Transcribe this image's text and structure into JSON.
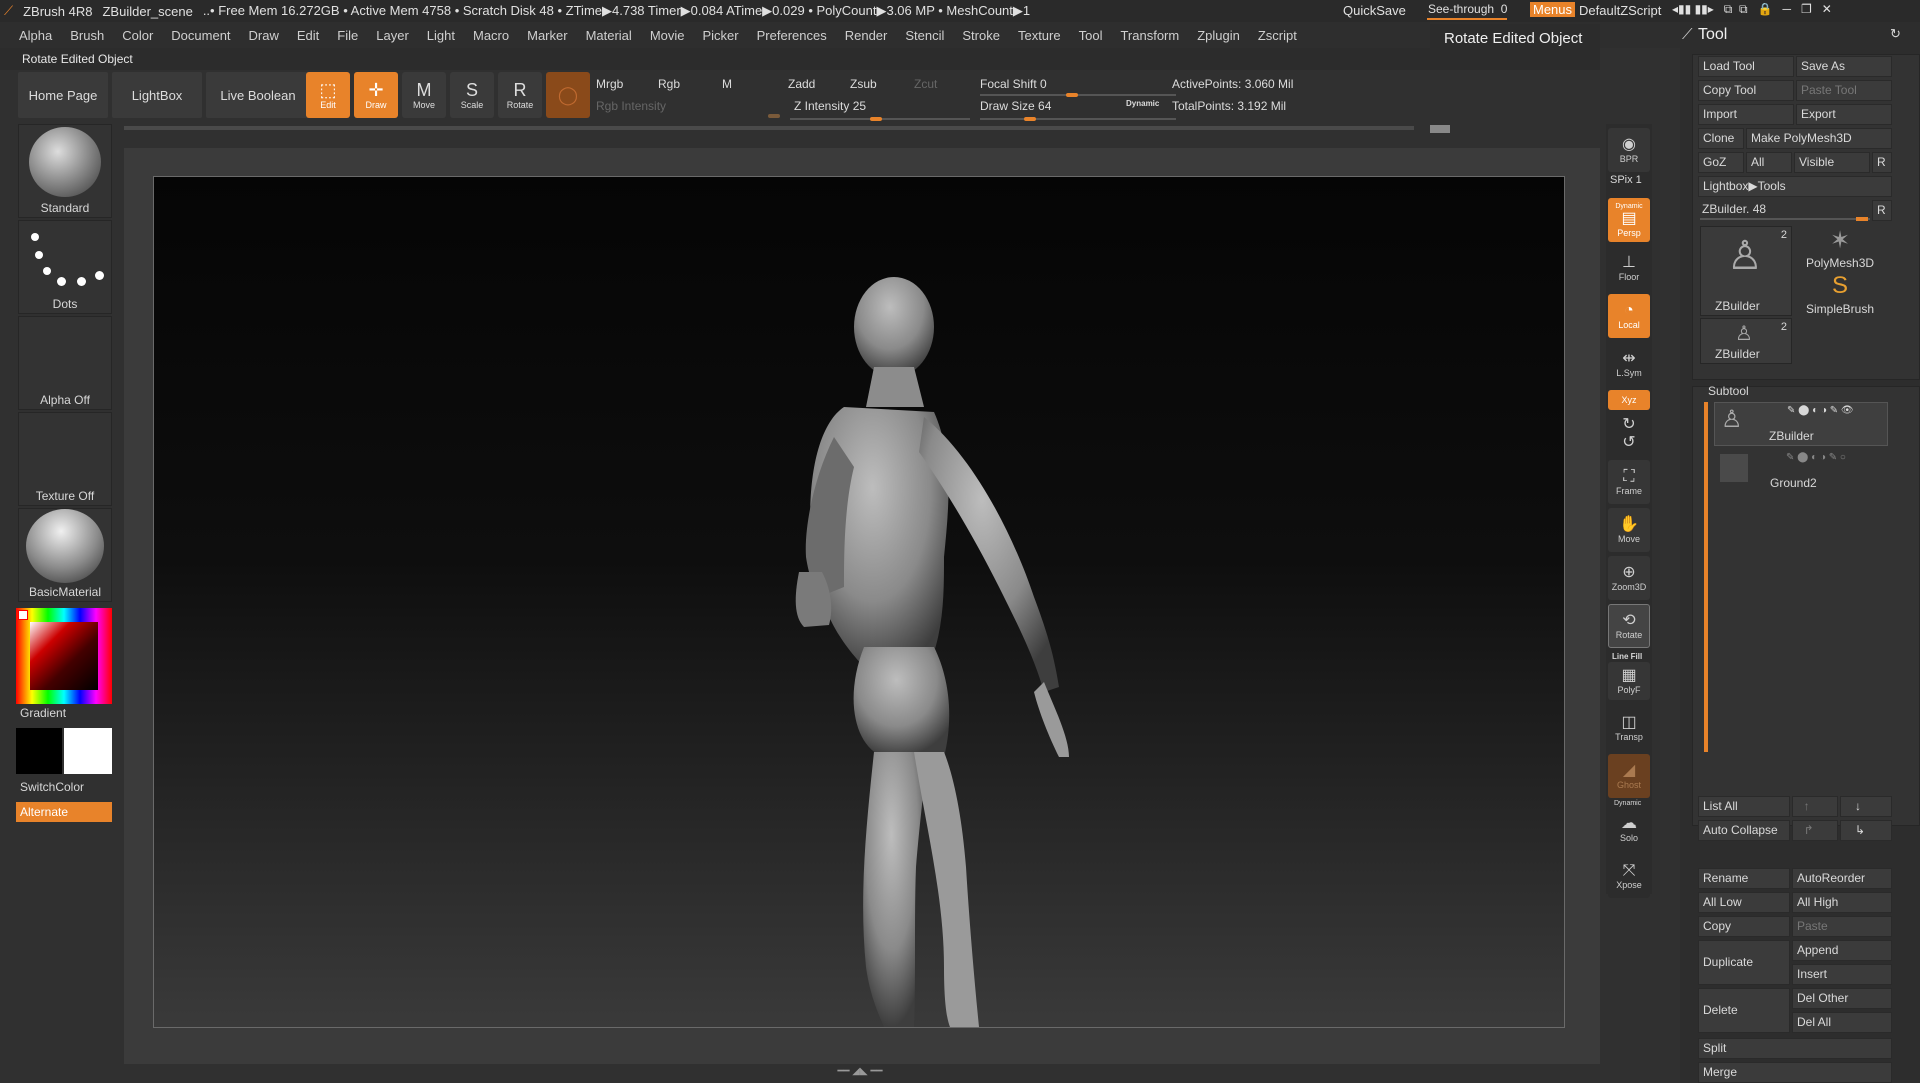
{
  "titlebar": {
    "app": "ZBrush 4R8",
    "scene": "ZBuilder_scene",
    "stats": "..• Free Mem 16.272GB • Active Mem 4758 • Scratch Disk 48 • ZTime▶4.738 Timer▶0.084 ATime▶0.029 • PolyCount▶3.06 MP • MeshCount▶1",
    "quicksave": "QuickSave",
    "seethrough_label": "See-through",
    "seethrough_value": "0",
    "menus": "Menus",
    "script": "DefaultZScript"
  },
  "menubar": [
    "Alpha",
    "Brush",
    "Color",
    "Document",
    "Draw",
    "Edit",
    "File",
    "Layer",
    "Light",
    "Macro",
    "Marker",
    "Material",
    "Movie",
    "Picker",
    "Preferences",
    "Render",
    "Stencil",
    "Stroke",
    "Texture",
    "Tool",
    "Transform",
    "Zplugin",
    "Zscript"
  ],
  "status_tip": "Rotate Edited Object",
  "tooltip": "Rotate Edited Object",
  "shelf": {
    "home": "Home Page",
    "lightbox": "LightBox",
    "liveboolean": "Live Boolean",
    "edit": "Edit",
    "draw": "Draw",
    "move": "Move",
    "scale": "Scale",
    "rotate": "Rotate",
    "mrgb": "Mrgb",
    "rgb": "Rgb",
    "m": "M",
    "rgb_intensity": "Rgb Intensity",
    "zadd": "Zadd",
    "zsub": "Zsub",
    "zcut": "Zcut",
    "z_intensity_label": "Z Intensity",
    "z_intensity_value": "25",
    "focal_shift_label": "Focal Shift",
    "focal_shift_value": "0",
    "draw_size_label": "Draw Size",
    "draw_size_value": "64",
    "dynamic": "Dynamic",
    "active_points": "ActivePoints: 3.060 Mil",
    "total_points": "TotalPoints: 3.192 Mil"
  },
  "left": {
    "brush": "Standard",
    "stroke": "Dots",
    "alpha": "Alpha Off",
    "texture": "Texture Off",
    "material": "BasicMaterial",
    "gradient": "Gradient",
    "switchcolor": "SwitchColor",
    "alternate": "Alternate"
  },
  "rshelf": {
    "bpr": "BPR",
    "spix": "SPix 1",
    "dynamic": "Dynamic",
    "persp": "Persp",
    "floor": "Floor",
    "local": "Local",
    "lsym": "L.Sym",
    "xyz": "Xyz",
    "frame": "Frame",
    "move": "Move",
    "zoom3d": "Zoom3D",
    "rotate": "Rotate",
    "linefill": "Line Fill",
    "polyf": "PolyF",
    "transp": "Transp",
    "ghost": "Ghost",
    "dynamic2": "Dynamic",
    "solo": "Solo",
    "xpose": "Xpose"
  },
  "tool": {
    "title": "Tool",
    "load": "Load Tool",
    "saveas": "Save As",
    "copy": "Copy Tool",
    "paste": "Paste Tool",
    "import": "Import",
    "export": "Export",
    "clone": "Clone",
    "makepoly": "Make PolyMesh3D",
    "goz": "GoZ",
    "all": "All",
    "visible": "Visible",
    "r": "R",
    "lightbox_tools": "Lightbox▶Tools",
    "zbuilder_label": "ZBuilder. 48",
    "r2": "R",
    "thumb1": "ZBuilder",
    "thumb1_count": "2",
    "thumb2": "PolyMesh3D",
    "thumb3": "SimpleBrush",
    "thumb4": "ZBuilder",
    "thumb4_count": "2",
    "subtool": "Subtool",
    "sub1": "ZBuilder",
    "sub2": "Ground2",
    "listall": "List All",
    "autocollapse": "Auto Collapse",
    "rename": "Rename",
    "autoreorder": "AutoReorder",
    "alllow": "All Low",
    "allhigh": "All High",
    "copy2": "Copy",
    "paste2": "Paste",
    "duplicate": "Duplicate",
    "append": "Append",
    "insert": "Insert",
    "delete": "Delete",
    "delother": "Del Other",
    "delall": "Del All",
    "split": "Split",
    "merge": "Merge"
  },
  "colors": {
    "accent": "#e8832a",
    "bg": "#303030"
  }
}
